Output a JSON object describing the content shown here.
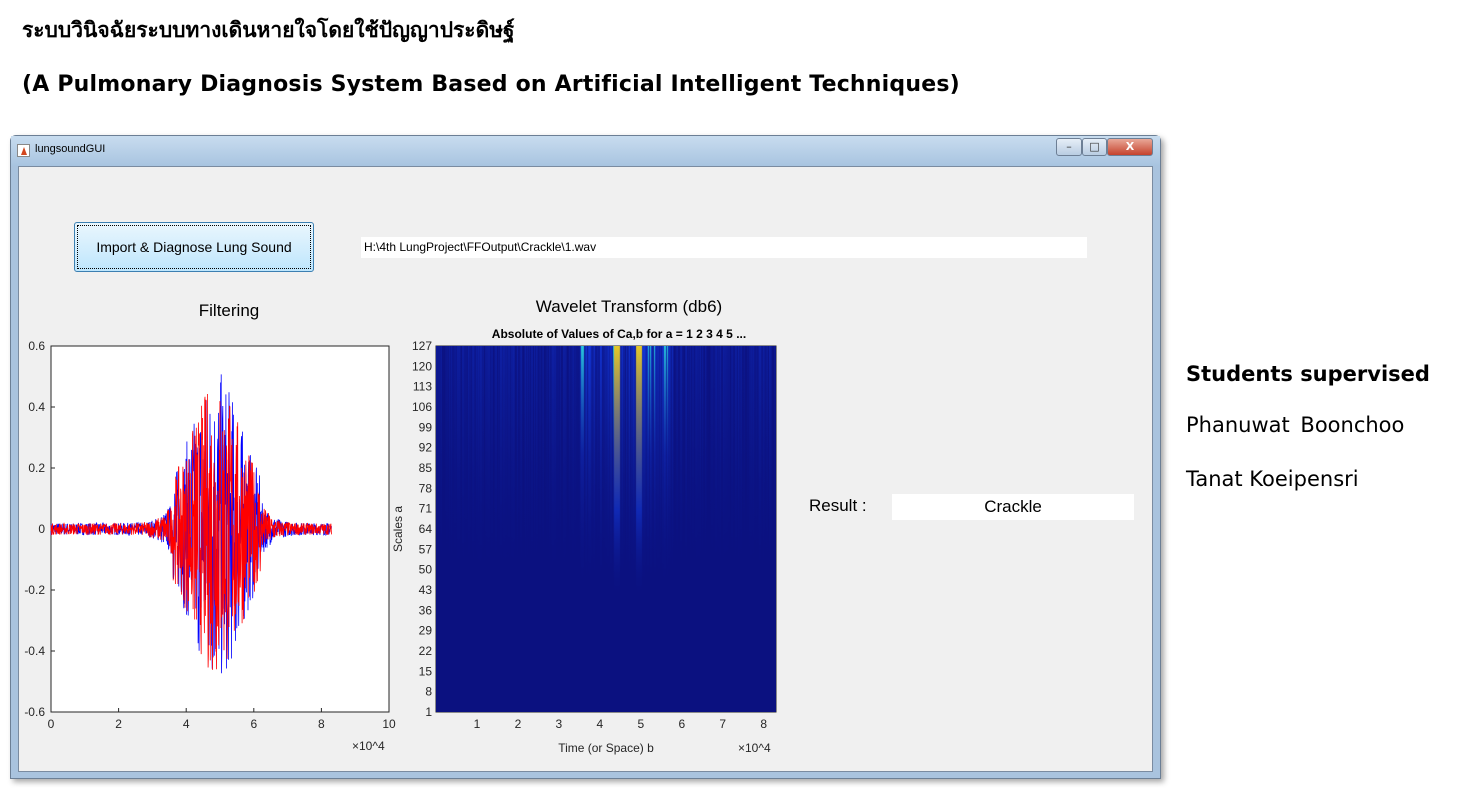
{
  "header": {
    "title_th": "ระบบวินิจฉัยระบบทางเดินหายใจโดยใช้ปัญญาประดิษฐ์",
    "title_en": "(A Pulmonary Diagnosis System Based on Artificial Intelligent Techniques)"
  },
  "window": {
    "title": "lungsoundGUI",
    "minimize": "–",
    "maximize": "□",
    "close": "X"
  },
  "app": {
    "import_button": "Import & Diagnose Lung Sound",
    "file_path": "H:\\4th LungProject\\FFOutput\\Crackle\\1.wav",
    "result_label": "Result :",
    "result_value": "Crackle"
  },
  "sidebar": {
    "heading": "Students supervised",
    "students": [
      "Phanuwat  Boonchoo",
      "Tanat Koeipensri"
    ]
  },
  "chart_data": [
    {
      "type": "line",
      "title": "Filtering",
      "xlim": [
        0,
        100000
      ],
      "ylim": [
        -0.6,
        0.6
      ],
      "x_multiplier": "×10^4",
      "xticks": [
        "0",
        "2",
        "4",
        "6",
        "8",
        "10"
      ],
      "yticks": [
        "-0.6",
        "-0.4",
        "-0.2",
        "0",
        "0.2",
        "0.4",
        "0.6"
      ],
      "signal_extent_x": [
        0,
        83000
      ],
      "peak_y": [
        -0.53,
        0.55
      ],
      "burst_center_x": 49000,
      "series_colors": [
        "#0000ff",
        "#ff0000"
      ]
    },
    {
      "type": "heatmap",
      "title": "Wavelet Transform (db6)",
      "subtitle": "Absolute of Values of Ca,b for a =  1 2 3 4 5 ...",
      "xlabel": "Time (or Space) b",
      "ylabel": "Scales a",
      "x_multiplier": "×10^4",
      "xlim": [
        0,
        83000
      ],
      "xticks": [
        "1",
        "2",
        "3",
        "4",
        "5",
        "6",
        "7",
        "8"
      ],
      "yticks": [
        "1",
        "8",
        "15",
        "22",
        "29",
        "36",
        "43",
        "50",
        "57",
        "64",
        "71",
        "78",
        "85",
        "92",
        "99",
        "106",
        "113",
        "120",
        "127"
      ],
      "colormap": "parula",
      "high_energy_x": [
        44000,
        49500
      ]
    }
  ]
}
